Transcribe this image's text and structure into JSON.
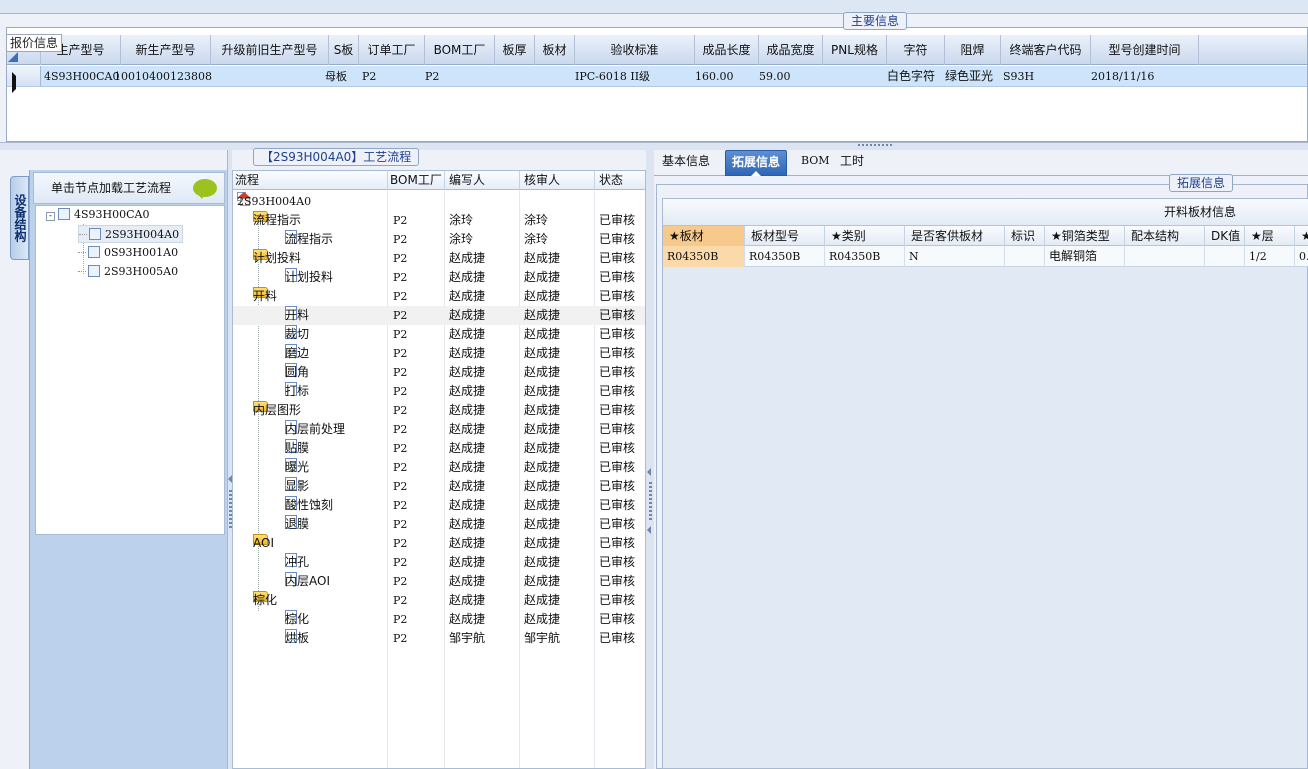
{
  "quote_tag": "报价信息",
  "main_info": {
    "title": "主要信息",
    "columns": [
      "生产型号",
      "新生产型号",
      "升级前旧生产型号",
      "S板",
      "订单工厂",
      "BOM工厂",
      "板厚",
      "板材",
      "验收标准",
      "成品长度",
      "成品宽度",
      "PNL规格",
      "字符",
      "阻焊",
      "终端客户代码",
      "型号创建时间"
    ],
    "row": [
      "4S93H00CA0",
      "10010400123808",
      "",
      "母板",
      "P2",
      "P2",
      "",
      "",
      "IPC-6018 II级",
      "160.00",
      "59.00",
      "",
      "白色字符",
      "绿色亚光",
      "S93H",
      "2018/11/16"
    ]
  },
  "left_pane": {
    "vertical_tab": "设备结构",
    "header": "单击节点加载工艺流程",
    "tree": [
      {
        "label": "4S93H00CA0",
        "root": true
      },
      {
        "label": "2S93H004A0"
      },
      {
        "label": "0S93H001A0"
      },
      {
        "label": "2S93H005A0"
      }
    ]
  },
  "flow": {
    "title": "【2S93H004A0】工艺流程",
    "columns": [
      "流程",
      "BOM工厂",
      "编写人",
      "核审人",
      "状态"
    ],
    "root": "2S93H004A0",
    "rows": [
      {
        "name": "流程指示",
        "level": 1,
        "folder": true,
        "bom": "P2",
        "writer": "涂玲",
        "reviewer": "涂玲",
        "status": "已审核"
      },
      {
        "name": "流程指示",
        "level": 2,
        "bom": "P2",
        "writer": "涂玲",
        "reviewer": "涂玲",
        "status": "已审核"
      },
      {
        "name": "计划投料",
        "level": 1,
        "folder": true,
        "bom": "P2",
        "writer": "赵成捷",
        "reviewer": "赵成捷",
        "status": "已审核"
      },
      {
        "name": "计划投料",
        "level": 2,
        "bom": "P2",
        "writer": "赵成捷",
        "reviewer": "赵成捷",
        "status": "已审核"
      },
      {
        "name": "开料",
        "level": 1,
        "folder": true,
        "bom": "P2",
        "writer": "赵成捷",
        "reviewer": "赵成捷",
        "status": "已审核"
      },
      {
        "name": "开料",
        "level": 2,
        "bom": "P2",
        "writer": "赵成捷",
        "reviewer": "赵成捷",
        "status": "已审核",
        "selected": true
      },
      {
        "name": "裁切",
        "level": 2,
        "bom": "P2",
        "writer": "赵成捷",
        "reviewer": "赵成捷",
        "status": "已审核"
      },
      {
        "name": "磨边",
        "level": 2,
        "bom": "P2",
        "writer": "赵成捷",
        "reviewer": "赵成捷",
        "status": "已审核"
      },
      {
        "name": "圆角",
        "level": 2,
        "bom": "P2",
        "writer": "赵成捷",
        "reviewer": "赵成捷",
        "status": "已审核"
      },
      {
        "name": "打标",
        "level": 2,
        "bom": "P2",
        "writer": "赵成捷",
        "reviewer": "赵成捷",
        "status": "已审核"
      },
      {
        "name": "内层图形",
        "level": 1,
        "folder": true,
        "bom": "P2",
        "writer": "赵成捷",
        "reviewer": "赵成捷",
        "status": "已审核"
      },
      {
        "name": "内层前处理",
        "level": 2,
        "bom": "P2",
        "writer": "赵成捷",
        "reviewer": "赵成捷",
        "status": "已审核"
      },
      {
        "name": "贴膜",
        "level": 2,
        "bom": "P2",
        "writer": "赵成捷",
        "reviewer": "赵成捷",
        "status": "已审核"
      },
      {
        "name": "曝光",
        "level": 2,
        "bom": "P2",
        "writer": "赵成捷",
        "reviewer": "赵成捷",
        "status": "已审核"
      },
      {
        "name": "显影",
        "level": 2,
        "bom": "P2",
        "writer": "赵成捷",
        "reviewer": "赵成捷",
        "status": "已审核"
      },
      {
        "name": "酸性蚀刻",
        "level": 2,
        "bom": "P2",
        "writer": "赵成捷",
        "reviewer": "赵成捷",
        "status": "已审核"
      },
      {
        "name": "退膜",
        "level": 2,
        "bom": "P2",
        "writer": "赵成捷",
        "reviewer": "赵成捷",
        "status": "已审核"
      },
      {
        "name": "AOI",
        "level": 1,
        "folder": true,
        "bom": "P2",
        "writer": "赵成捷",
        "reviewer": "赵成捷",
        "status": "已审核"
      },
      {
        "name": "冲孔",
        "level": 2,
        "bom": "P2",
        "writer": "赵成捷",
        "reviewer": "赵成捷",
        "status": "已审核"
      },
      {
        "name": "内层AOI",
        "level": 2,
        "bom": "P2",
        "writer": "赵成捷",
        "reviewer": "赵成捷",
        "status": "已审核"
      },
      {
        "name": "棕化",
        "level": 1,
        "folder": true,
        "bom": "P2",
        "writer": "赵成捷",
        "reviewer": "赵成捷",
        "status": "已审核"
      },
      {
        "name": "棕化",
        "level": 2,
        "bom": "P2",
        "writer": "赵成捷",
        "reviewer": "赵成捷",
        "status": "已审核"
      },
      {
        "name": "烘板",
        "level": 2,
        "bom": "P2",
        "writer": "邹宇航",
        "reviewer": "邹宇航",
        "status": "已审核"
      }
    ]
  },
  "right_pane": {
    "tabs": [
      "基本信息",
      "拓展信息",
      "BOM",
      "工时"
    ],
    "active_tab": 1,
    "group_title": "拓展信息",
    "grid_title": "开料板材信息",
    "columns": [
      "★板材",
      "板材型号",
      "★类别",
      "是否客供板材",
      "标识",
      "★铜箔类型",
      "配本结构",
      "DK值",
      "★层",
      "★"
    ],
    "row": [
      "R04350B",
      "R04350B",
      "R04350B",
      "N",
      "",
      "电解铜箔",
      "",
      "",
      "1/2",
      "0."
    ]
  }
}
